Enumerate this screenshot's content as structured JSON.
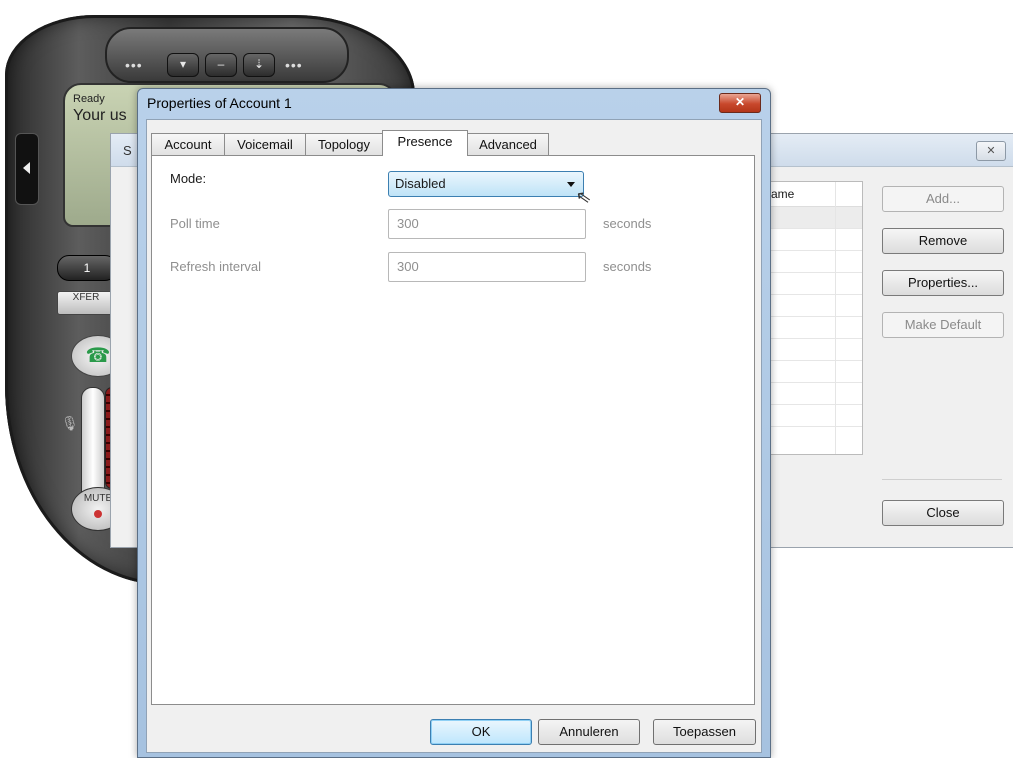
{
  "phone": {
    "status_line": "Ready",
    "user_line": "Your us",
    "key_label": "1",
    "xfer_label": "XFER",
    "mute_label": "MUTE"
  },
  "accounts_window": {
    "title_fragment": "S",
    "column_header_fragment": "ame",
    "buttons": {
      "add": "Add...",
      "remove": "Remove",
      "properties": "Properties...",
      "make_default": "Make Default",
      "close": "Close"
    }
  },
  "dialog": {
    "title": "Properties of Account 1",
    "tabs": [
      {
        "label": "Account"
      },
      {
        "label": "Voicemail"
      },
      {
        "label": "Topology"
      },
      {
        "label": "Presence",
        "active": true
      },
      {
        "label": "Advanced"
      }
    ],
    "presence": {
      "mode_label": "Mode:",
      "mode_value": "Disabled",
      "poll_time_label": "Poll time",
      "poll_time_value": "300",
      "poll_time_unit": "seconds",
      "refresh_label": "Refresh interval",
      "refresh_value": "300",
      "refresh_unit": "seconds"
    },
    "buttons": {
      "ok": "OK",
      "cancel": "Annuleren",
      "apply": "Toepassen"
    }
  },
  "colors": {
    "dialog_frame": "#b9d1ea",
    "close_button": "#c8482c",
    "focus_blue": "#3c7fb1"
  }
}
